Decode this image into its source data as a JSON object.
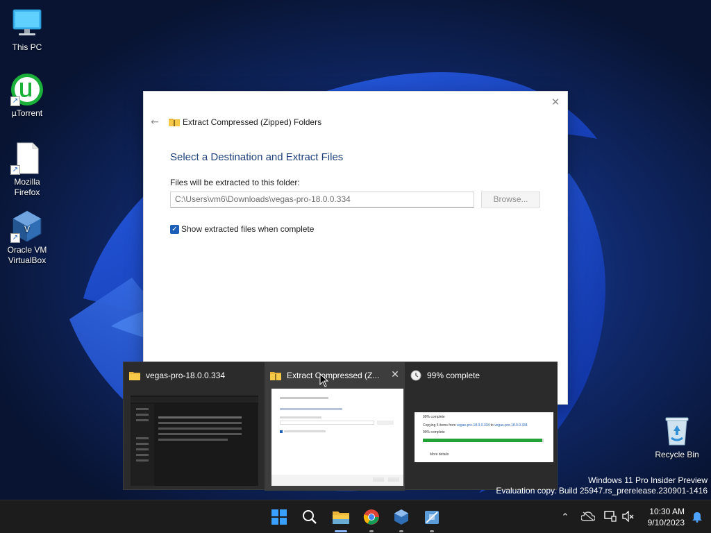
{
  "desktop": {
    "icons": [
      {
        "label": "This PC",
        "icon": "monitor-icon"
      },
      {
        "label": "µTorrent",
        "icon": "utorrent-icon"
      },
      {
        "label": "Mozilla Firefox",
        "icon": "blank-file-icon"
      },
      {
        "label": "Oracle VM VirtualBox",
        "icon": "virtualbox-icon"
      },
      {
        "label": "Recycle Bin",
        "icon": "recycle-bin-icon"
      }
    ]
  },
  "dialog": {
    "title": "Extract Compressed (Zipped) Folders",
    "heading": "Select a Destination and Extract Files",
    "folder_label": "Files will be extracted to this folder:",
    "folder_path": "C:\\Users\\vm6\\Downloads\\vegas-pro-18.0.0.334",
    "browse_label": "Browse...",
    "show_files_label": "Show extracted files when complete",
    "show_files_checked": true
  },
  "previews": [
    {
      "title": "vegas-pro-18.0.0.334",
      "icon": "folder-icon",
      "active": false
    },
    {
      "title": "Extract Compressed (Z...",
      "icon": "zip-folder-icon",
      "active": true,
      "close": "✕"
    },
    {
      "title": "99% complete",
      "icon": "clock-icon",
      "active": false,
      "thumb_title": "99% complete",
      "thumb_copy_prefix": "Copying 5 items from",
      "thumb_copy_from": "vegas-pro-18.0.0.334",
      "thumb_copy_to_word": "to",
      "thumb_copy_to": "vegas-pro-18.0.0.334",
      "thumb_percent": "99% complete",
      "thumb_more": "More details",
      "progress": 0.99
    }
  ],
  "watermark": {
    "line1": "Windows 11 Pro Insider Preview",
    "line2": "Evaluation copy. Build 25947.rs_prerelease.230901-1416"
  },
  "taskbar": {
    "apps": [
      "start-icon",
      "search-icon",
      "file-explorer-icon",
      "chrome-icon",
      "virtualbox-icon",
      "zip-tool-icon"
    ],
    "clock_time": "10:30 AM",
    "clock_date": "9/10/2023"
  },
  "colors": {
    "accent": "#1c5fb8",
    "heading": "#1e3f7a",
    "progress": "#23a337",
    "taskbar": "#1c1c1c"
  }
}
